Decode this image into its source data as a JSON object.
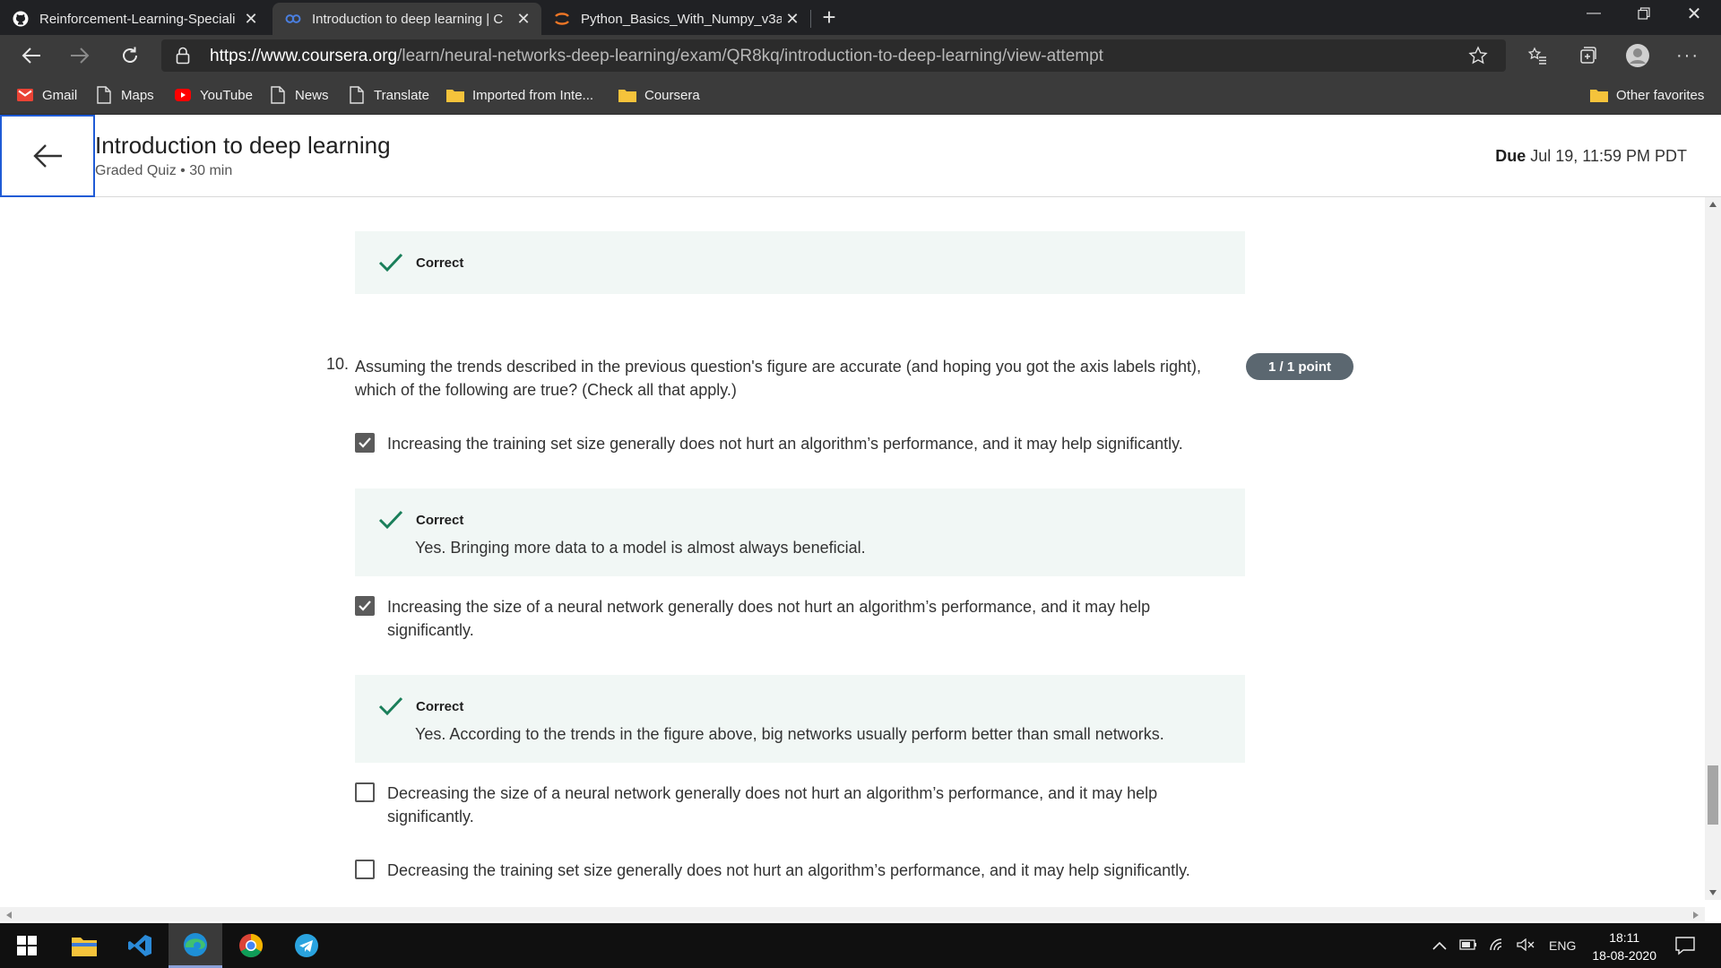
{
  "browser": {
    "tabs": [
      {
        "title": "Reinforcement-Learning-Speciali",
        "icon": "github-icon"
      },
      {
        "title": "Introduction to deep learning | C",
        "icon": "coursera-icon"
      },
      {
        "title": "Python_Basics_With_Numpy_v3a",
        "icon": "jupyter-icon"
      }
    ],
    "url_prefix": "https://",
    "url_host": "www.coursera.org",
    "url_path": "/learn/neural-networks-deep-learning/exam/QR8kq/introduction-to-deep-learning/view-attempt",
    "bookmarks": [
      "Gmail",
      "Maps",
      "YouTube",
      "News",
      "Translate",
      "Imported from Inte...",
      "Coursera"
    ],
    "other_favorites": "Other favorites"
  },
  "header": {
    "title": "Introduction to deep learning",
    "subtitle": "Graded Quiz • 30 min",
    "due_label": "Due",
    "due_value": "Jul 19, 11:59 PM PDT"
  },
  "prev_feedback": {
    "label": "Correct"
  },
  "question": {
    "number": "10.",
    "text": "Assuming the trends described in the previous question's figure are accurate (and hoping you got the axis labels right), which of the following are true? (Check all that apply.)",
    "points": "1 / 1 point",
    "options": [
      {
        "text": "Increasing the training set size generally does not hurt an algorithm’s performance, and it may help significantly.",
        "checked": true
      },
      {
        "text": "Increasing the size of a neural network generally does not hurt an algorithm’s performance, and it may help significantly.",
        "checked": true
      },
      {
        "text": "Decreasing the size of a neural network generally does not hurt an algorithm’s performance, and it may help significantly.",
        "checked": false
      },
      {
        "text": "Decreasing the training set size generally does not hurt an algorithm’s performance, and it may help significantly.",
        "checked": false
      }
    ],
    "feedback": [
      {
        "label": "Correct",
        "text": "Yes. Bringing more data to a model is almost always beneficial."
      },
      {
        "label": "Correct",
        "text": "Yes. According to the trends in the figure above, big networks usually perform better than small networks."
      }
    ]
  },
  "taskbar": {
    "language": "ENG",
    "time": "18:11",
    "date": "18-08-2020"
  },
  "colors": {
    "correct_green": "#1a7f5a",
    "feedback_bg": "#f1f7f5",
    "points_bg": "#5b6770"
  }
}
